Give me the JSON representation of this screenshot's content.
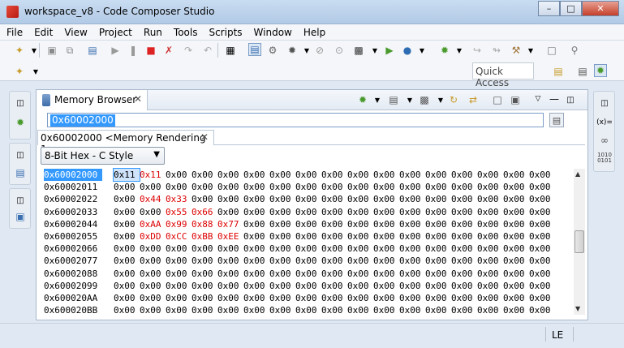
{
  "window": {
    "title": "workspace_v8 - Code Composer Studio"
  },
  "menu": [
    "File",
    "Edit",
    "View",
    "Project",
    "Run",
    "Tools",
    "Scripts",
    "Window",
    "Help"
  ],
  "quick_access": "Quick Access",
  "view": {
    "tab_label": "Memory Browser",
    "address_input": "0x60002000",
    "rendering_tab": "0x60002000 <Memory Rendering 1>",
    "format": "8-Bit Hex - C Style"
  },
  "memory": {
    "rows": [
      {
        "address": "0x60002000",
        "bytes": [
          "0x11",
          "0x11",
          "0x00",
          "0x00",
          "0x00",
          "0x00",
          "0x00",
          "0x00",
          "0x00",
          "0x00",
          "0x00",
          "0x00",
          "0x00",
          "0x00",
          "0x00",
          "0x00",
          "0x00"
        ]
      },
      {
        "address": "0x60002011",
        "bytes": [
          "0x00",
          "0x00",
          "0x00",
          "0x00",
          "0x00",
          "0x00",
          "0x00",
          "0x00",
          "0x00",
          "0x00",
          "0x00",
          "0x00",
          "0x00",
          "0x00",
          "0x00",
          "0x00",
          "0x00"
        ]
      },
      {
        "address": "0x60002022",
        "bytes": [
          "0x00",
          "0x44",
          "0x33",
          "0x00",
          "0x00",
          "0x00",
          "0x00",
          "0x00",
          "0x00",
          "0x00",
          "0x00",
          "0x00",
          "0x00",
          "0x00",
          "0x00",
          "0x00",
          "0x00"
        ]
      },
      {
        "address": "0x60002033",
        "bytes": [
          "0x00",
          "0x00",
          "0x55",
          "0x66",
          "0x00",
          "0x00",
          "0x00",
          "0x00",
          "0x00",
          "0x00",
          "0x00",
          "0x00",
          "0x00",
          "0x00",
          "0x00",
          "0x00",
          "0x00"
        ]
      },
      {
        "address": "0x60002044",
        "bytes": [
          "0x00",
          "0xAA",
          "0x99",
          "0x88",
          "0x77",
          "0x00",
          "0x00",
          "0x00",
          "0x00",
          "0x00",
          "0x00",
          "0x00",
          "0x00",
          "0x00",
          "0x00",
          "0x00",
          "0x00"
        ]
      },
      {
        "address": "0x60002055",
        "bytes": [
          "0x00",
          "0xDD",
          "0xCC",
          "0xBB",
          "0xEE",
          "0x00",
          "0x00",
          "0x00",
          "0x00",
          "0x00",
          "0x00",
          "0x00",
          "0x00",
          "0x00",
          "0x00",
          "0x00",
          "0x00"
        ]
      },
      {
        "address": "0x60002066",
        "bytes": [
          "0x00",
          "0x00",
          "0x00",
          "0x00",
          "0x00",
          "0x00",
          "0x00",
          "0x00",
          "0x00",
          "0x00",
          "0x00",
          "0x00",
          "0x00",
          "0x00",
          "0x00",
          "0x00",
          "0x00"
        ]
      },
      {
        "address": "0x60002077",
        "bytes": [
          "0x00",
          "0x00",
          "0x00",
          "0x00",
          "0x00",
          "0x00",
          "0x00",
          "0x00",
          "0x00",
          "0x00",
          "0x00",
          "0x00",
          "0x00",
          "0x00",
          "0x00",
          "0x00",
          "0x00"
        ]
      },
      {
        "address": "0x60002088",
        "bytes": [
          "0x00",
          "0x00",
          "0x00",
          "0x00",
          "0x00",
          "0x00",
          "0x00",
          "0x00",
          "0x00",
          "0x00",
          "0x00",
          "0x00",
          "0x00",
          "0x00",
          "0x00",
          "0x00",
          "0x00"
        ]
      },
      {
        "address": "0x60002099",
        "bytes": [
          "0x00",
          "0x00",
          "0x00",
          "0x00",
          "0x00",
          "0x00",
          "0x00",
          "0x00",
          "0x00",
          "0x00",
          "0x00",
          "0x00",
          "0x00",
          "0x00",
          "0x00",
          "0x00",
          "0x00"
        ]
      },
      {
        "address": "0x600020AA",
        "bytes": [
          "0x00",
          "0x00",
          "0x00",
          "0x00",
          "0x00",
          "0x00",
          "0x00",
          "0x00",
          "0x00",
          "0x00",
          "0x00",
          "0x00",
          "0x00",
          "0x00",
          "0x00",
          "0x00",
          "0x00"
        ]
      },
      {
        "address": "0x600020BB",
        "bytes": [
          "0x00",
          "0x00",
          "0x00",
          "0x00",
          "0x00",
          "0x00",
          "0x00",
          "0x00",
          "0x00",
          "0x00",
          "0x00",
          "0x00",
          "0x00",
          "0x00",
          "0x00",
          "0x00",
          "0x00"
        ]
      }
    ],
    "changed_color": "#dd0000",
    "selection_color": "#3399ff"
  },
  "status": {
    "endian": "LE"
  }
}
